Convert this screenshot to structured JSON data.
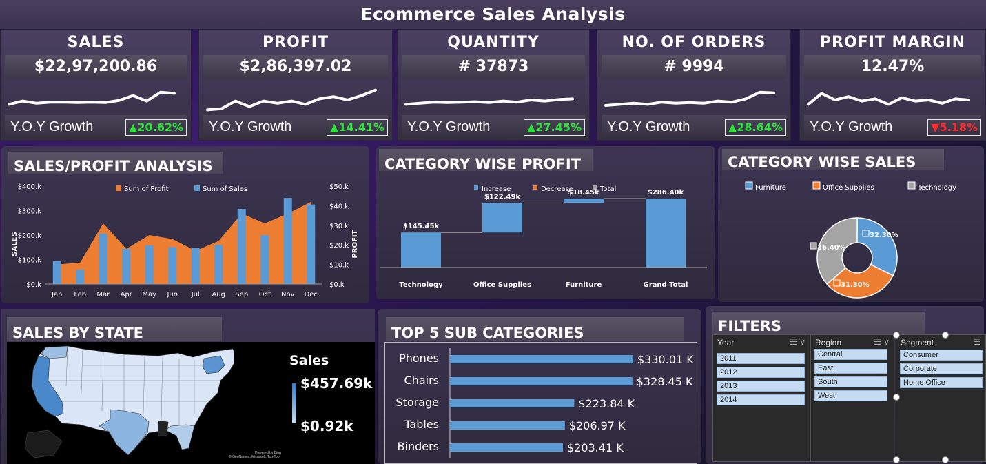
{
  "title": "Ecommerce Sales Analysis",
  "kpis": [
    {
      "name": "SALES",
      "value": "$22,97,200.86",
      "yoy_label": "Y.O.Y Growth",
      "yoy": "20.62%",
      "dir": "up",
      "spark": [
        0.3,
        0.45,
        0.35,
        0.4,
        0.4,
        0.38,
        0.4,
        0.38,
        0.48,
        0.7,
        0.45,
        0.85,
        0.8
      ]
    },
    {
      "name": "PROFIT",
      "value": "$2,86,397.02",
      "yoy_label": "Y.O.Y Growth",
      "yoy": "14.41%",
      "dir": "up",
      "spark": [
        0.05,
        0.1,
        0.45,
        0.2,
        0.45,
        0.35,
        0.45,
        0.3,
        0.55,
        0.65,
        0.5,
        0.7,
        0.95
      ]
    },
    {
      "name": "QUANTITY",
      "value": "# 37873",
      "yoy_label": "Y.O.Y Growth",
      "yoy": "27.45%",
      "dir": "up",
      "spark": [
        0.3,
        0.35,
        0.4,
        0.38,
        0.4,
        0.42,
        0.38,
        0.45,
        0.4,
        0.5,
        0.45,
        0.52,
        0.55
      ]
    },
    {
      "name": "NO. OF ORDERS",
      "value": "# 9994",
      "yoy_label": "Y.O.Y Growth",
      "yoy": "28.64%",
      "dir": "up",
      "spark": [
        0.25,
        0.3,
        0.35,
        0.3,
        0.4,
        0.35,
        0.38,
        0.35,
        0.45,
        0.4,
        0.55,
        0.85,
        0.82
      ]
    },
    {
      "name": "PROFIT MARGIN",
      "value": "12.47%",
      "yoy_label": "Y.O.Y Growth",
      "yoy": "5.18%",
      "dir": "down",
      "spark": [
        0.3,
        0.8,
        0.5,
        0.65,
        0.45,
        0.55,
        0.3,
        0.6,
        0.45,
        0.5,
        0.35,
        0.55,
        0.5
      ]
    }
  ],
  "panels": {
    "sales_profit": "SALES/PROFIT ANALYSIS",
    "category_profit": "CATEGORY WISE PROFIT",
    "category_sales": "CATEGORY WISE SALES",
    "sales_by_state": "SALES BY STATE",
    "top5": "TOP 5 SUB CATEGORIES",
    "filters": "FILTERS"
  },
  "chart_data": [
    {
      "type": "bar",
      "title": "SALES/PROFIT ANALYSIS",
      "categories": [
        "Jan",
        "Feb",
        "Mar",
        "Apr",
        "May",
        "Jun",
        "Jul",
        "Aug",
        "Sep",
        "Oct",
        "Nov",
        "Dec"
      ],
      "series": [
        {
          "name": "Sum of Profit",
          "kind": "area",
          "axis": "right",
          "color": "#ed7d31",
          "values": [
            10000,
            11000,
            31000,
            18000,
            25000,
            23000,
            17000,
            22000,
            36000,
            31000,
            36000,
            42000
          ]
        },
        {
          "name": "Sum of Sales",
          "kind": "bar",
          "axis": "left",
          "color": "#5b9bd5",
          "values": [
            94000,
            59000,
            206000,
            144000,
            158000,
            151000,
            147000,
            160000,
            307000,
            200000,
            352000,
            325000
          ]
        }
      ],
      "ylabel": "SALES",
      "y2label": "PROFIT",
      "ylim": [
        0,
        400000
      ],
      "y2lim": [
        0,
        50000
      ],
      "yticks": [
        "$0.k",
        "$100.k",
        "$200.k",
        "$300.k",
        "$400.k"
      ],
      "y2ticks": [
        "$0.k",
        "$10.k",
        "$20.k",
        "$30.k",
        "$40.k",
        "$50.k"
      ],
      "legend": "top"
    },
    {
      "type": "bar",
      "subtype": "waterfall",
      "title": "CATEGORY WISE PROFIT",
      "categories": [
        "Technology",
        "Office Supplies",
        "Furniture",
        "Grand Total"
      ],
      "values": [
        145.45,
        122.49,
        18.45,
        286.4
      ],
      "labels": [
        "$145.45k",
        "$122.49k",
        "$18.45k",
        "$286.40k"
      ],
      "legend_items": [
        "Increase",
        "Decrease",
        "Total"
      ],
      "legend_colors": [
        "#5b9bd5",
        "#ed7d31",
        "#a5a5a5"
      ],
      "legend": "top"
    },
    {
      "type": "pie",
      "subtype": "doughnut",
      "title": "CATEGORY WISE SALES",
      "categories": [
        "Furniture",
        "Office Supplies",
        "Technology"
      ],
      "values": [
        32.3,
        31.3,
        36.4
      ],
      "labels": [
        "32.30%",
        "31.30%",
        "36.40%"
      ],
      "colors": [
        "#5b9bd5",
        "#ed7d31",
        "#a5a5a5"
      ],
      "legend": "top"
    },
    {
      "type": "bar",
      "title": "TOP 5 SUB CATEGORIES",
      "orientation": "horizontal",
      "categories": [
        "Phones",
        "Chairs",
        "Storage",
        "Tables",
        "Binders"
      ],
      "values": [
        330.01,
        328.45,
        223.84,
        206.97,
        203.41
      ],
      "labels": [
        "$330.01 K",
        "$328.45 K",
        "$223.84 K",
        "$206.97 K",
        "$203.41 K"
      ]
    }
  ],
  "map": {
    "legend_title": "Sales",
    "max": "$457.69k",
    "min": "$0.92k",
    "credit1": "Powered by Bing",
    "credit2": "© GeoNames, Microsoft, TomTom"
  },
  "filters": {
    "year": {
      "header": "Year",
      "items": [
        "2011",
        "2012",
        "2013",
        "2014"
      ]
    },
    "region": {
      "header": "Region",
      "items": [
        "Central",
        "East",
        "South",
        "West"
      ]
    },
    "segment": {
      "header": "Segment",
      "items": [
        "Consumer",
        "Corporate",
        "Home Office"
      ]
    }
  }
}
